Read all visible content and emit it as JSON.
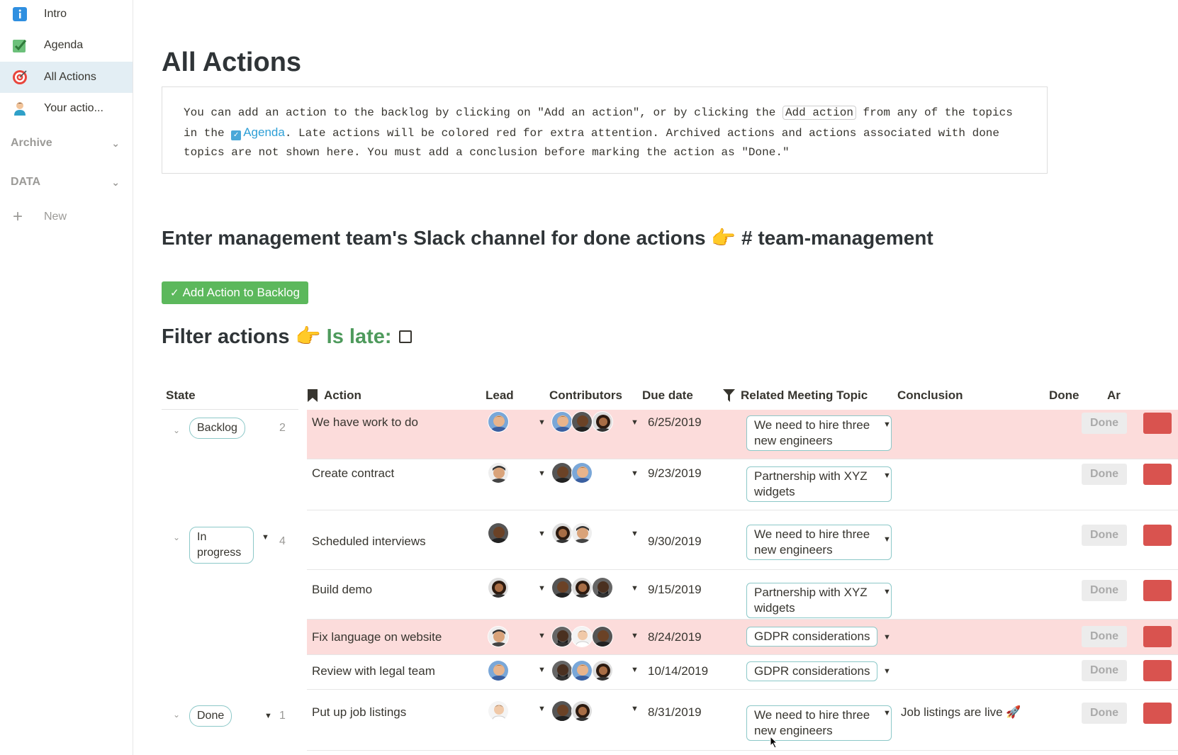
{
  "sidebar": {
    "items": [
      {
        "label": "Intro",
        "icon": "info-icon"
      },
      {
        "label": "Agenda",
        "icon": "checkbox-icon"
      },
      {
        "label": "All Actions",
        "icon": "target-icon"
      },
      {
        "label": "Your actio...",
        "icon": "person-icon"
      }
    ],
    "sections": [
      {
        "label": "Archive"
      },
      {
        "label": "DATA"
      }
    ],
    "new_label": "New"
  },
  "page": {
    "title": "All Actions",
    "callout": {
      "part1": "You can add an action to the backlog by clicking on \"Add an action\", or by clicking the ",
      "code": "Add action",
      "part2": " from any of the topics in the ",
      "mention": "Agenda",
      "part3": ". Late actions will be colored red for extra attention. Archived actions and actions associated with done topics are not shown here. You must add a conclusion before marking the action as \"Done.\""
    },
    "slack_heading": "Enter management team's Slack channel for done actions 👉 # team-management",
    "add_button": "Add Action to Backlog",
    "filter": {
      "label": "Filter actions 👉",
      "late_label": "Is late:"
    }
  },
  "table": {
    "headers": {
      "state": "State",
      "action": "Action",
      "lead": "Lead",
      "contributors": "Contributors",
      "due": "Due date",
      "topic": "Related Meeting Topic",
      "conclusion": "Conclusion",
      "done": "Done",
      "ar": "Ar"
    },
    "groups": [
      {
        "label": "Backlog",
        "count": "2"
      },
      {
        "label": "In progress",
        "count": "4"
      },
      {
        "label": "Done",
        "count": "1"
      }
    ],
    "rows": [
      {
        "action": "We have work to do",
        "due": "6/25/2019",
        "topic": "We need to hire three new engineers",
        "conclusion": "",
        "done": "Done",
        "late": true
      },
      {
        "action": "Create contract",
        "due": "9/23/2019",
        "topic": "Partnership with XYZ widgets",
        "conclusion": "",
        "done": "Done",
        "late": false
      },
      {
        "action": "Scheduled interviews",
        "due": "9/30/2019",
        "topic": "We need to hire three new engineers",
        "conclusion": "",
        "done": "Done",
        "late": false
      },
      {
        "action": "Build demo",
        "due": "9/15/2019",
        "topic": "Partnership with XYZ widgets",
        "conclusion": "",
        "done": "Done",
        "late": false
      },
      {
        "action": "Fix language on website",
        "due": "8/24/2019",
        "topic": "GDPR considerations",
        "conclusion": "",
        "done": "Done",
        "late": true
      },
      {
        "action": "Review with legal team",
        "due": "10/14/2019",
        "topic": "GDPR considerations",
        "conclusion": "",
        "done": "Done",
        "late": false
      },
      {
        "action": "Put up job listings",
        "due": "8/31/2019",
        "topic": "We need to hire three new engineers",
        "conclusion": "Job listings are live 🚀",
        "done": "Done",
        "late": false
      }
    ]
  },
  "colors": {
    "late_row": "#fcdcdb",
    "accent_green": "#5cb85c",
    "late_label": "#4e9a5c",
    "archive_red": "#d9534f",
    "active_nav": "#e3eef4"
  }
}
